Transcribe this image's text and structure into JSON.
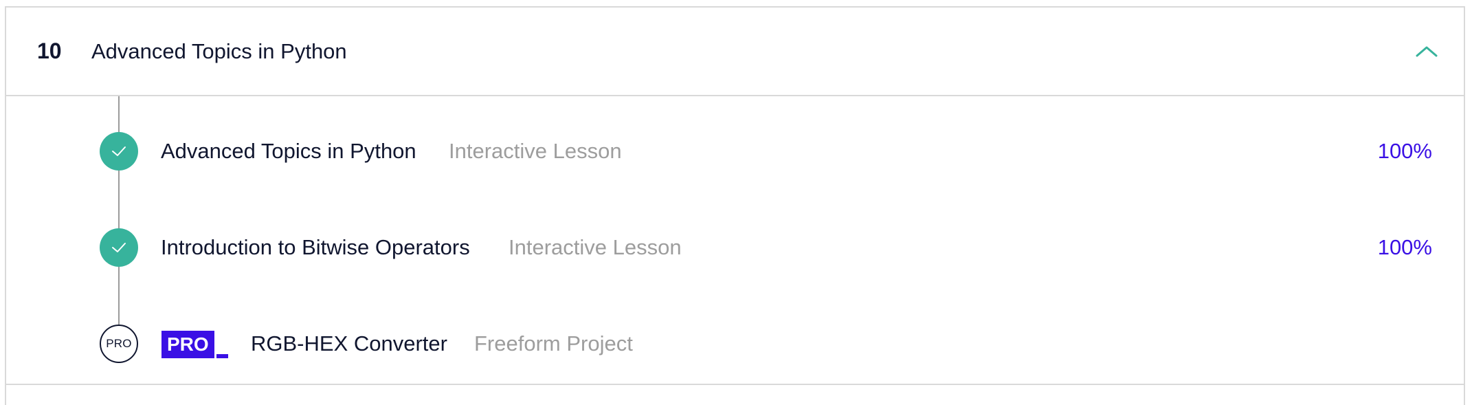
{
  "module": {
    "number": "10",
    "title": "Advanced Topics in Python",
    "toggle_icon": "chevron-up-icon"
  },
  "items": [
    {
      "status": "completed",
      "status_icon": "check-icon",
      "title": "Advanced Topics in Python",
      "kind": "Interactive Lesson",
      "progress": "100%"
    },
    {
      "status": "completed",
      "status_icon": "check-icon",
      "title": "Introduction to Bitwise Operators",
      "kind": "Interactive Lesson",
      "progress": "100%"
    },
    {
      "status": "locked",
      "node_label": "PRO",
      "badge": "PRO",
      "title": "RGB-HEX Converter",
      "kind": "Freeform Project"
    }
  ],
  "colors": {
    "accent_teal": "#37b39c",
    "accent_purple": "#3a10e5",
    "text_dark": "#10162f",
    "text_muted": "#9d9d9d",
    "border": "#d9d9d9"
  }
}
